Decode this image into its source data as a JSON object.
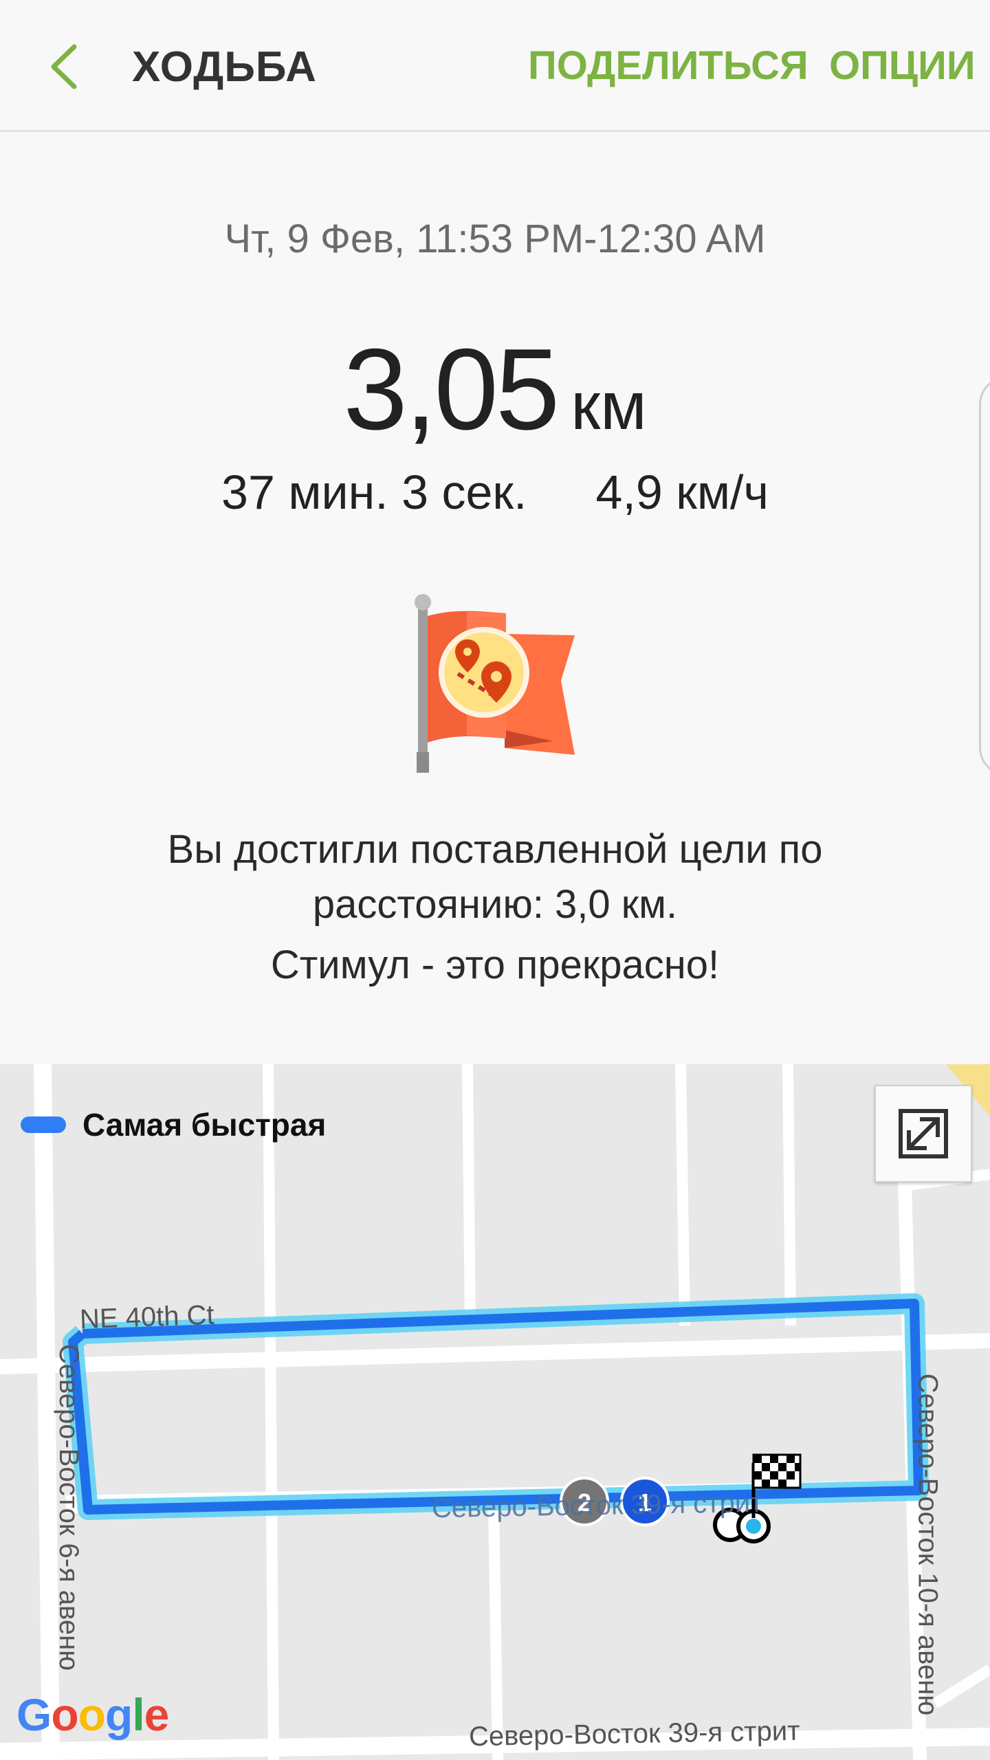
{
  "header": {
    "title": "ХОДЬБА",
    "share_label": "ПОДЕЛИТЬСЯ",
    "options_label": "ОПЦИИ",
    "back_icon": "chevron-left-icon"
  },
  "summary": {
    "date_range": "Чт, 9 Фев, 11:53 PM-12:30 AM",
    "distance_value": "3,05",
    "distance_unit": "км",
    "duration": "37 мин. 3 сек.",
    "speed": "4,9 км/ч",
    "goal_icon": "goal-flag-icon",
    "goal_line1": "Вы достигли поставленной цели по",
    "goal_line2": "расстоянию: 3,0 км.",
    "goal_line3": "Стимул - это прекрасно!"
  },
  "map": {
    "legend_label": "Самая быстрая",
    "expand_icon": "expand-icon",
    "route_color": "#2f7ef5",
    "streets": {
      "ne_40th": "NE 40th Ct",
      "ne_6th_ave": "Северо-Восток 6-я авеню",
      "ne_10th_ave": "Северо-Восток 10-я авеню",
      "ne_street_segment": "Северо-Восток 39-я стрит",
      "ne_39th_bottom": "Северо-Восток 39-я стрит"
    },
    "markers": {
      "marker_2": "2",
      "marker_1": "1"
    },
    "provider": "Google"
  },
  "colors": {
    "accent": "#7cb342",
    "route": "#2f7ef5",
    "background": "#f8f8f8"
  }
}
